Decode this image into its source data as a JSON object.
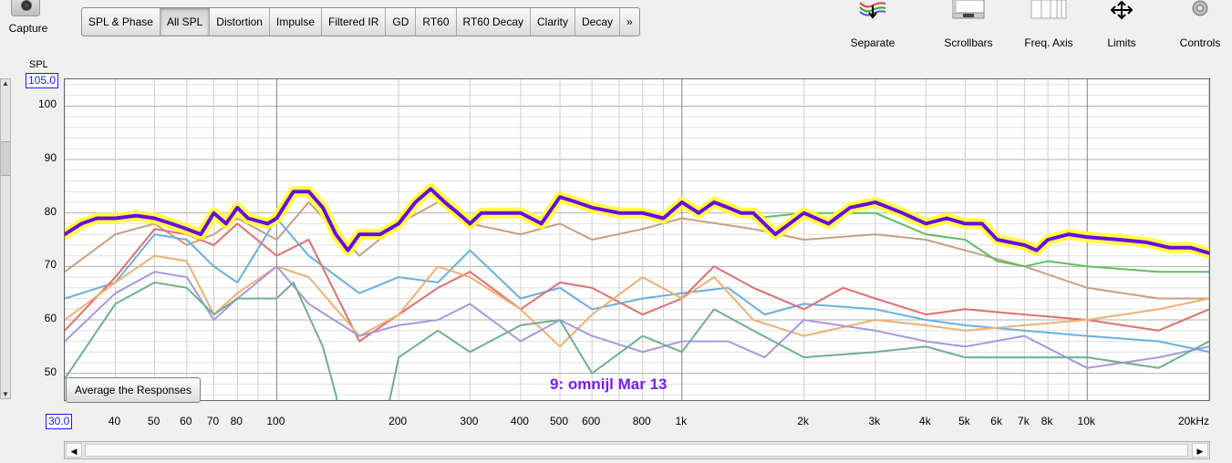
{
  "toolbar": {
    "capture_label": "Capture",
    "tabs": [
      "SPL & Phase",
      "All SPL",
      "Distortion",
      "Impulse",
      "Filtered IR",
      "GD",
      "RT60",
      "RT60 Decay",
      "Clarity",
      "Decay",
      "»"
    ],
    "active_tab": "All SPL",
    "right_buttons": [
      "Separate",
      "Scrollbars",
      "Freq. Axis",
      "Limits",
      "Controls"
    ]
  },
  "plot": {
    "y_title": "SPL",
    "y_top_value": "105.0",
    "x_left_value": "30.0",
    "x_unit": "kHz",
    "average_button": "Average the Responses",
    "overlay_label": "9: omnijl Mar 13",
    "highlight_color": "#ffff33",
    "main_series_color": "#6a0de0"
  },
  "chart_data": {
    "type": "line",
    "x_scale": "log",
    "xlim": [
      30,
      20000
    ],
    "ylim": [
      45,
      105
    ],
    "ylabel": "SPL",
    "y_ticks": [
      50,
      60,
      70,
      80,
      90,
      100
    ],
    "x_ticks": [
      {
        "v": 40,
        "l": "40"
      },
      {
        "v": 50,
        "l": "50"
      },
      {
        "v": 60,
        "l": "60"
      },
      {
        "v": 70,
        "l": "70"
      },
      {
        "v": 80,
        "l": "80"
      },
      {
        "v": 100,
        "l": "100"
      },
      {
        "v": 200,
        "l": "200"
      },
      {
        "v": 300,
        "l": "300"
      },
      {
        "v": 400,
        "l": "400"
      },
      {
        "v": 500,
        "l": "500"
      },
      {
        "v": 600,
        "l": "600"
      },
      {
        "v": 800,
        "l": "800"
      },
      {
        "v": 1000,
        "l": "1k"
      },
      {
        "v": 2000,
        "l": "2k"
      },
      {
        "v": 3000,
        "l": "3k"
      },
      {
        "v": 4000,
        "l": "4k"
      },
      {
        "v": 5000,
        "l": "5k"
      },
      {
        "v": 6000,
        "l": "6k"
      },
      {
        "v": 7000,
        "l": "7k"
      },
      {
        "v": 8000,
        "l": "8k"
      },
      {
        "v": 10000,
        "l": "10k"
      },
      {
        "v": 20000,
        "l": "20kHz"
      }
    ],
    "series": [
      {
        "color": "#c8a080",
        "values": [
          [
            30,
            69
          ],
          [
            40,
            76
          ],
          [
            50,
            78
          ],
          [
            60,
            74
          ],
          [
            70,
            76
          ],
          [
            80,
            79
          ],
          [
            100,
            75
          ],
          [
            120,
            82
          ],
          [
            160,
            72
          ],
          [
            200,
            78
          ],
          [
            250,
            82
          ],
          [
            300,
            78
          ],
          [
            400,
            76
          ],
          [
            500,
            78
          ],
          [
            600,
            75
          ],
          [
            800,
            77
          ],
          [
            1000,
            79
          ],
          [
            1500,
            77
          ],
          [
            2000,
            75
          ],
          [
            3000,
            76
          ],
          [
            4000,
            75
          ],
          [
            5000,
            73
          ],
          [
            7000,
            70
          ],
          [
            10000,
            66
          ],
          [
            15000,
            64
          ],
          [
            20000,
            64
          ]
        ]
      },
      {
        "color": "#6ab0e0",
        "values": [
          [
            30,
            64
          ],
          [
            40,
            67
          ],
          [
            50,
            76
          ],
          [
            60,
            75
          ],
          [
            70,
            70
          ],
          [
            80,
            67
          ],
          [
            100,
            79
          ],
          [
            120,
            72
          ],
          [
            160,
            65
          ],
          [
            200,
            68
          ],
          [
            250,
            67
          ],
          [
            300,
            73
          ],
          [
            400,
            64
          ],
          [
            500,
            66
          ],
          [
            600,
            62
          ],
          [
            800,
            64
          ],
          [
            1000,
            65
          ],
          [
            1300,
            66
          ],
          [
            1600,
            61
          ],
          [
            2000,
            63
          ],
          [
            3000,
            62
          ],
          [
            4000,
            60
          ],
          [
            5000,
            59
          ],
          [
            7000,
            58
          ],
          [
            10000,
            57
          ],
          [
            15000,
            56
          ],
          [
            20000,
            54
          ]
        ]
      },
      {
        "color": "#e07070",
        "values": [
          [
            30,
            58
          ],
          [
            40,
            68
          ],
          [
            50,
            77
          ],
          [
            60,
            76
          ],
          [
            70,
            74
          ],
          [
            80,
            78
          ],
          [
            100,
            72
          ],
          [
            120,
            75
          ],
          [
            160,
            56
          ],
          [
            200,
            61
          ],
          [
            250,
            66
          ],
          [
            300,
            69
          ],
          [
            400,
            62
          ],
          [
            500,
            67
          ],
          [
            600,
            66
          ],
          [
            800,
            61
          ],
          [
            1000,
            64
          ],
          [
            1200,
            70
          ],
          [
            1500,
            66
          ],
          [
            2000,
            62
          ],
          [
            2500,
            66
          ],
          [
            3000,
            64
          ],
          [
            4000,
            61
          ],
          [
            5000,
            62
          ],
          [
            7000,
            61
          ],
          [
            10000,
            60
          ],
          [
            15000,
            58
          ],
          [
            20000,
            62
          ]
        ]
      },
      {
        "color": "#f0b070",
        "values": [
          [
            30,
            60
          ],
          [
            40,
            67
          ],
          [
            50,
            72
          ],
          [
            60,
            71
          ],
          [
            70,
            61
          ],
          [
            80,
            65
          ],
          [
            100,
            70
          ],
          [
            120,
            68
          ],
          [
            160,
            57
          ],
          [
            200,
            61
          ],
          [
            250,
            70
          ],
          [
            300,
            68
          ],
          [
            400,
            62
          ],
          [
            500,
            55
          ],
          [
            600,
            61
          ],
          [
            800,
            68
          ],
          [
            1000,
            64
          ],
          [
            1200,
            68
          ],
          [
            1500,
            60
          ],
          [
            2000,
            57
          ],
          [
            3000,
            60
          ],
          [
            4000,
            59
          ],
          [
            5000,
            58
          ],
          [
            7000,
            59
          ],
          [
            10000,
            60
          ],
          [
            15000,
            62
          ],
          [
            20000,
            64
          ]
        ]
      },
      {
        "color": "#a898e0",
        "values": [
          [
            30,
            56
          ],
          [
            40,
            65
          ],
          [
            50,
            69
          ],
          [
            60,
            68
          ],
          [
            70,
            60
          ],
          [
            80,
            64
          ],
          [
            100,
            70
          ],
          [
            120,
            63
          ],
          [
            160,
            57
          ],
          [
            200,
            59
          ],
          [
            250,
            60
          ],
          [
            300,
            63
          ],
          [
            400,
            56
          ],
          [
            500,
            60
          ],
          [
            600,
            57
          ],
          [
            800,
            54
          ],
          [
            1000,
            56
          ],
          [
            1300,
            56
          ],
          [
            1600,
            53
          ],
          [
            2000,
            60
          ],
          [
            3000,
            58
          ],
          [
            4000,
            56
          ],
          [
            5000,
            55
          ],
          [
            7000,
            57
          ],
          [
            10000,
            51
          ],
          [
            15000,
            53
          ],
          [
            20000,
            55
          ]
        ]
      },
      {
        "color": "#70b090",
        "values": [
          [
            30,
            49
          ],
          [
            40,
            63
          ],
          [
            50,
            67
          ],
          [
            60,
            66
          ],
          [
            70,
            61
          ],
          [
            80,
            64
          ],
          [
            100,
            64
          ],
          [
            110,
            67
          ],
          [
            130,
            55
          ],
          [
            140,
            46
          ],
          [
            145,
            40
          ],
          [
            160,
            43
          ],
          [
            190,
            45
          ],
          [
            200,
            53
          ],
          [
            250,
            58
          ],
          [
            300,
            54
          ],
          [
            400,
            59
          ],
          [
            500,
            60
          ],
          [
            600,
            50
          ],
          [
            800,
            57
          ],
          [
            1000,
            54
          ],
          [
            1200,
            62
          ],
          [
            1500,
            58
          ],
          [
            2000,
            53
          ],
          [
            3000,
            54
          ],
          [
            4000,
            55
          ],
          [
            5000,
            53
          ],
          [
            7000,
            53
          ],
          [
            10000,
            53
          ],
          [
            15000,
            51
          ],
          [
            20000,
            56
          ]
        ]
      },
      {
        "color": "#60c060",
        "values": [
          [
            1500,
            79
          ],
          [
            2000,
            80
          ],
          [
            3000,
            80
          ],
          [
            4000,
            76
          ],
          [
            5000,
            75
          ],
          [
            6000,
            71
          ],
          [
            7000,
            70
          ],
          [
            8000,
            71
          ],
          [
            10000,
            70
          ],
          [
            15000,
            69
          ],
          [
            20000,
            69
          ]
        ]
      },
      {
        "color": "#6a0de0",
        "main": true,
        "values": [
          [
            30,
            76
          ],
          [
            33,
            78
          ],
          [
            36,
            79
          ],
          [
            40,
            79
          ],
          [
            45,
            79.5
          ],
          [
            50,
            79
          ],
          [
            55,
            78
          ],
          [
            60,
            77
          ],
          [
            65,
            76
          ],
          [
            70,
            80
          ],
          [
            75,
            78
          ],
          [
            80,
            81
          ],
          [
            85,
            79
          ],
          [
            90,
            78.5
          ],
          [
            95,
            78
          ],
          [
            100,
            79
          ],
          [
            110,
            84
          ],
          [
            120,
            84
          ],
          [
            130,
            81
          ],
          [
            140,
            76
          ],
          [
            150,
            73
          ],
          [
            160,
            76
          ],
          [
            180,
            76
          ],
          [
            200,
            78
          ],
          [
            220,
            82
          ],
          [
            240,
            84.5
          ],
          [
            260,
            82
          ],
          [
            280,
            80
          ],
          [
            300,
            78
          ],
          [
            320,
            80
          ],
          [
            350,
            80
          ],
          [
            400,
            80
          ],
          [
            450,
            78
          ],
          [
            500,
            83
          ],
          [
            550,
            82
          ],
          [
            600,
            81
          ],
          [
            700,
            80
          ],
          [
            800,
            80
          ],
          [
            900,
            79
          ],
          [
            1000,
            82
          ],
          [
            1100,
            80
          ],
          [
            1200,
            82
          ],
          [
            1300,
            81
          ],
          [
            1400,
            80
          ],
          [
            1500,
            80
          ],
          [
            1700,
            76
          ],
          [
            2000,
            80
          ],
          [
            2300,
            78
          ],
          [
            2600,
            81
          ],
          [
            3000,
            82
          ],
          [
            3500,
            80
          ],
          [
            4000,
            78
          ],
          [
            4500,
            79
          ],
          [
            5000,
            78
          ],
          [
            5500,
            78
          ],
          [
            6000,
            75
          ],
          [
            7000,
            74
          ],
          [
            7500,
            73
          ],
          [
            8000,
            75
          ],
          [
            9000,
            76
          ],
          [
            10000,
            75.5
          ],
          [
            12000,
            75
          ],
          [
            14000,
            74.5
          ],
          [
            16000,
            73.5
          ],
          [
            18000,
            73.5
          ],
          [
            20000,
            72.5
          ]
        ]
      }
    ]
  }
}
